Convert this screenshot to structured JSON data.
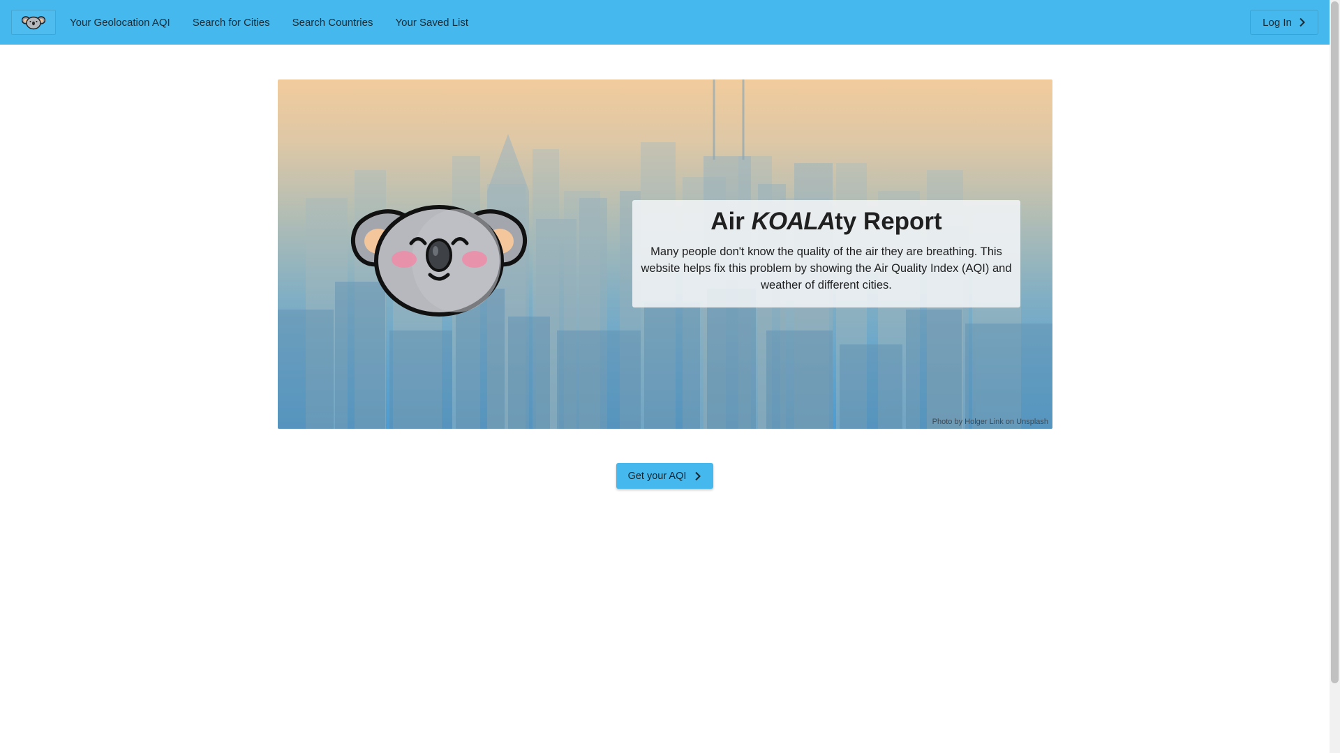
{
  "nav": {
    "logo_icon": "koala-icon",
    "links": [
      {
        "label": "Your Geolocation AQI"
      },
      {
        "label": "Search for Cities"
      },
      {
        "label": "Search Countries"
      },
      {
        "label": "Your Saved List"
      }
    ],
    "login_label": "Log In",
    "login_icon": "chevron-right-icon",
    "accent_color": "#45b9ee"
  },
  "hero": {
    "title_prefix": "Air ",
    "title_emphasis": "KOALA",
    "title_suffix": "ty Report",
    "description": "Many people don't know the quality of the air they are breathing. This website helps fix this problem by showing the Air Quality Index (AQI) and weather of different cities.",
    "photo_credit": "Photo by Holger Link on Unsplash",
    "mascot_icon": "koala-face-icon"
  },
  "cta": {
    "label": "Get your AQI",
    "icon": "chevron-right-icon"
  }
}
